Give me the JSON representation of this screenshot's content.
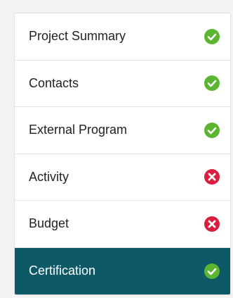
{
  "steps": [
    {
      "label": "Project Summary",
      "status": "complete",
      "icon": "check-circle-icon"
    },
    {
      "label": "Contacts",
      "status": "complete",
      "icon": "check-circle-icon"
    },
    {
      "label": "External Program",
      "status": "complete",
      "icon": "check-circle-icon"
    },
    {
      "label": "Activity",
      "status": "error",
      "icon": "x-circle-icon"
    },
    {
      "label": "Budget",
      "status": "error",
      "icon": "x-circle-icon"
    },
    {
      "label": "Certification",
      "status": "complete",
      "icon": "check-circle-icon",
      "active": true
    }
  ],
  "colors": {
    "complete": "#5cb531",
    "error": "#d81f40",
    "active_bg": "#0e5968",
    "active_text": "#ffffff"
  }
}
